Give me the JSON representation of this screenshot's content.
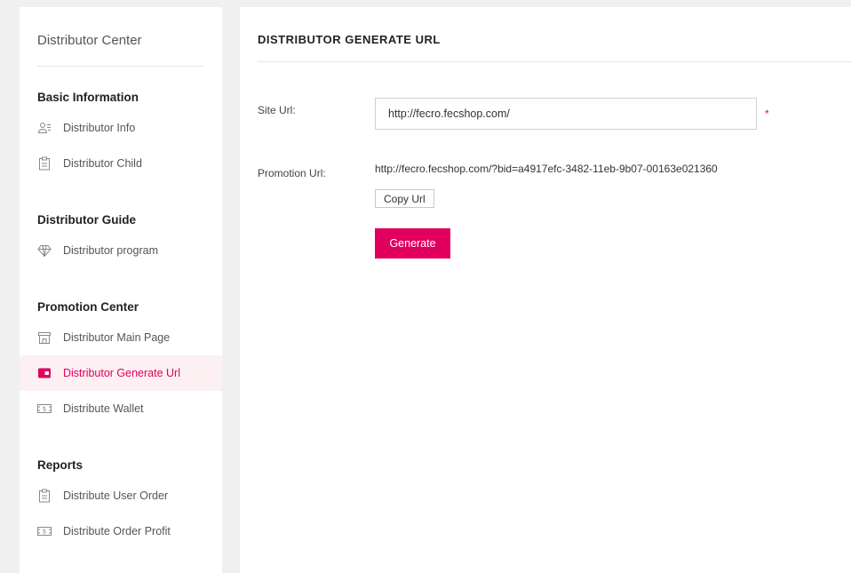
{
  "sidebar": {
    "title": "Distributor Center",
    "sections": [
      {
        "title": "Basic Information",
        "items": [
          {
            "label": "Distributor Info",
            "icon": "user-card-icon"
          },
          {
            "label": "Distributor Child",
            "icon": "clipboard-icon"
          }
        ]
      },
      {
        "title": "Distributor Guide",
        "items": [
          {
            "label": "Distributor program",
            "icon": "diamond-icon"
          }
        ]
      },
      {
        "title": "Promotion Center",
        "items": [
          {
            "label": "Distributor Main Page",
            "icon": "store-icon"
          },
          {
            "label": "Distributor Generate Url",
            "icon": "wallet-icon",
            "active": true
          },
          {
            "label": "Distribute Wallet",
            "icon": "money-icon"
          }
        ]
      },
      {
        "title": "Reports",
        "items": [
          {
            "label": "Distribute User Order",
            "icon": "clipboard-icon"
          },
          {
            "label": "Distribute Order Profit",
            "icon": "money-icon"
          }
        ]
      }
    ]
  },
  "main": {
    "title": "DISTRIBUTOR GENERATE URL",
    "site_url_label": "Site Url:",
    "site_url_value": "http://fecro.fecshop.com/",
    "required_mark": "*",
    "promotion_url_label": "Promotion Url:",
    "promotion_url_value": "http://fecro.fecshop.com/?bid=a4917efc-3482-11eb-9b07-00163e021360",
    "copy_button": "Copy Url",
    "generate_button": "Generate"
  },
  "colors": {
    "accent": "#e2005f",
    "active_bg": "#fcf0f3",
    "page_bg": "#f0f0f0"
  }
}
